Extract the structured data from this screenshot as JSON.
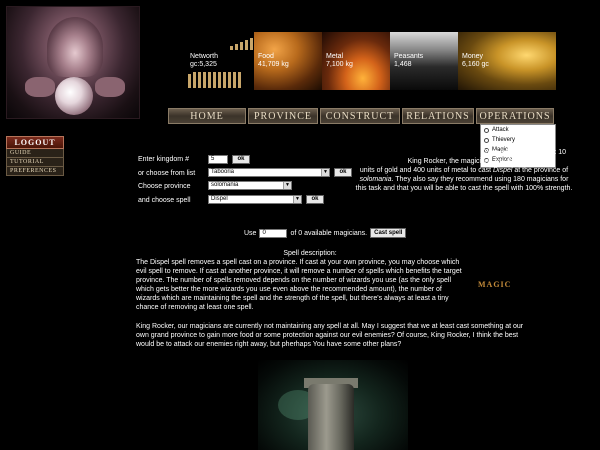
{
  "resources": {
    "networth": {
      "label": "Networth",
      "value": "gc:5,325"
    },
    "food": {
      "label": "Food",
      "value": "41,709 kg"
    },
    "metal": {
      "label": "Metal",
      "value": "7,100 kg"
    },
    "peasants": {
      "label": "Peasants",
      "value": "1,468"
    },
    "money": {
      "label": "Money",
      "value": "6,160 gc"
    }
  },
  "nav": {
    "home": "HOME",
    "province": "PROVINCE",
    "construct": "CONSTRUCT",
    "relations": "RELATIONS",
    "operations": "OPERATIONS"
  },
  "operations_menu": {
    "items": [
      {
        "label": "Attack",
        "selected": false
      },
      {
        "label": "Thievery",
        "selected": false
      },
      {
        "label": "Magic",
        "selected": true
      },
      {
        "label": "Explore",
        "selected": false
      }
    ]
  },
  "sidebar": {
    "logout": "LOGOUT",
    "guide": "GUIDE",
    "tutorial": "TUTORIAL",
    "preferences": "PREFERENCES"
  },
  "form": {
    "kingdom_label": "Enter kingdom #",
    "kingdom_value": "5",
    "list_label": "or choose from list",
    "list_value": "Tabooria",
    "province_label": "Choose province",
    "province_value": "solomania",
    "spell_label": "and choose spell",
    "spell_value": "Dispel",
    "ok_label": "ok"
  },
  "advice": {
    "mana": "Your mana percentage: 10",
    "line_a": "King Rocker, the magicians say they",
    "line_b": "units of gold and 400 units of metal to cast",
    "spell_italic": "Dispel",
    "line_c": "at the province of",
    "province_italic": "solomania",
    "line_d": ". They also say they recommend using 180 magicians for this task and that you will be able to cast the spell with 100% strength."
  },
  "cast": {
    "use_label": "Use",
    "use_value": "0",
    "of_text": "of 0 available magicians.",
    "cast_button": "Cast spell"
  },
  "description": {
    "title": "Spell description:",
    "text": "The Dispel spell removes a spell cast on a province. If cast at your own province, you may choose which evil spell to remove. If cast at another province, it will remove a number of spells which benefits the target province. The number of spells removed depends on the number of wizards you use (as the only spell which gets better the more wizards you use even above the recommended amount), the number of wizards which are maintaining the spell and the strength of the spell, but there's always at least a tiny chance of removing at least one spell."
  },
  "plans": "King Rocker, our magicians are currently not maintaining any spell at all. May I suggest that we at least cast something at our own grand province to gain more food or some protection against our evil enemies? Of course, King Rocker, I think the best would be to attack our enemies right away, but pherhaps You have some other plans?",
  "magic_label": "MAGIC"
}
